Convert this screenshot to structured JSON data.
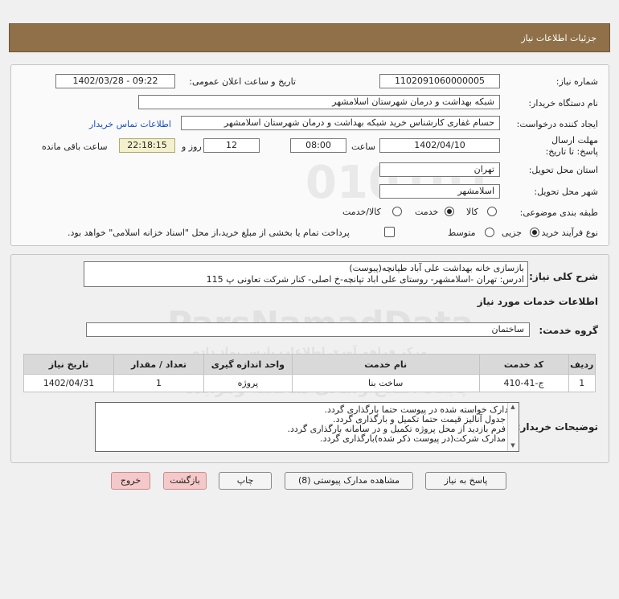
{
  "header": {
    "title": "جزئیات اطلاعات نیاز"
  },
  "form": {
    "need_number_label": "شماره نیاز:",
    "need_number": "1102091060000005",
    "announce_label": "تاریخ و ساعت اعلان عمومی:",
    "announce_value": "1402/03/28 - 09:22",
    "buyer_org_label": "نام دستگاه خریدار:",
    "buyer_org": "شبکه بهداشت و درمان شهرستان اسلامشهر",
    "creator_label": "ایجاد کننده درخواست:",
    "creator": "حسام غفاری کارشناس خرید شبکه بهداشت و درمان شهرستان اسلامشهر",
    "contact_link": "اطلاعات تماس خریدار",
    "deadline_label": "مهلت ارسال پاسخ: تا تاریخ:",
    "deadline_date": "1402/04/10",
    "time_label": "ساعت",
    "deadline_time": "08:00",
    "days_value": "12",
    "days_label": "روز و",
    "remaining_time": "22:18:15",
    "remaining_label": "ساعت باقی مانده",
    "province_label": "استان محل تحویل:",
    "province": "تهران",
    "city_label": "شهر محل تحویل:",
    "city": "اسلامشهر",
    "category_label": "طبقه بندی موضوعی:",
    "category_options": [
      "کالا",
      "خدمت",
      "کالا/خدمت"
    ],
    "category_selected": "خدمت",
    "process_label": "نوع فرآیند خرید :",
    "process_options": [
      "جزیی",
      "متوسط"
    ],
    "process_selected": "جزیی",
    "payment_note": "پرداخت تمام یا بخشی از مبلغ خرید،از محل \"اسناد خزانه اسلامی\" خواهد بود."
  },
  "summary": {
    "label": "شرح کلی نیاز:",
    "line1": "بازسازی خانه بهداشت علی آباد طپانچه(پیوست)",
    "line2": "ادرس: تهران -اسلامشهر- روستای علی اباد تپانچه-خ اصلی- کنار شرکت تعاونی پ 115"
  },
  "services": {
    "section_title": "اطلاعات خدمات مورد نیاز",
    "group_label": "گروه خدمت:",
    "group_value": "ساختمان"
  },
  "table": {
    "headers": [
      "ردیف",
      "کد خدمت",
      "نام خدمت",
      "واحد اندازه گیری",
      "تعداد / مقدار",
      "تاریخ نیاز"
    ],
    "rows": [
      [
        "1",
        "ج-41-410",
        "ساخت بنا",
        "پروژه",
        "1",
        "1402/04/31"
      ]
    ]
  },
  "buyer_notes": {
    "label": "توضیحات خریدار:",
    "lines": [
      "مدارک خواسته شده در پیوست حتما بارگذاری گردد.",
      "• جدول آنالیز قیمت حتما تکمیل  و بارگذاری گردد.",
      "• فرم بازدید از محل پروژه تکمیل و در سامانه بارگذاری گردد.",
      "• مدارک شرکت(در پیوست ذکر شده)بارگذاری گردد."
    ]
  },
  "buttons": {
    "reply": "پاسخ به نیاز",
    "view_docs": "مشاهده مدارک پیوستی (8)",
    "print": "چاپ",
    "back": "بازگشت",
    "exit": "خروج"
  },
  "watermark": {
    "line1": "ParsNamadData",
    "line2": "مرکز فراهم آوری اطلاعات پارس نماد داده",
    "line3": "پایگاه اطلاع رسانی مناقصه ومزایده",
    "line4": "۰۲۱-۸۸۳۴۹۶۷۰"
  },
  "colors": {
    "header_bg": "#8f7048",
    "remaining_bg": "#f3f0cd",
    "link": "#1b4fc4",
    "exit_bg": "#f5c9c9"
  }
}
